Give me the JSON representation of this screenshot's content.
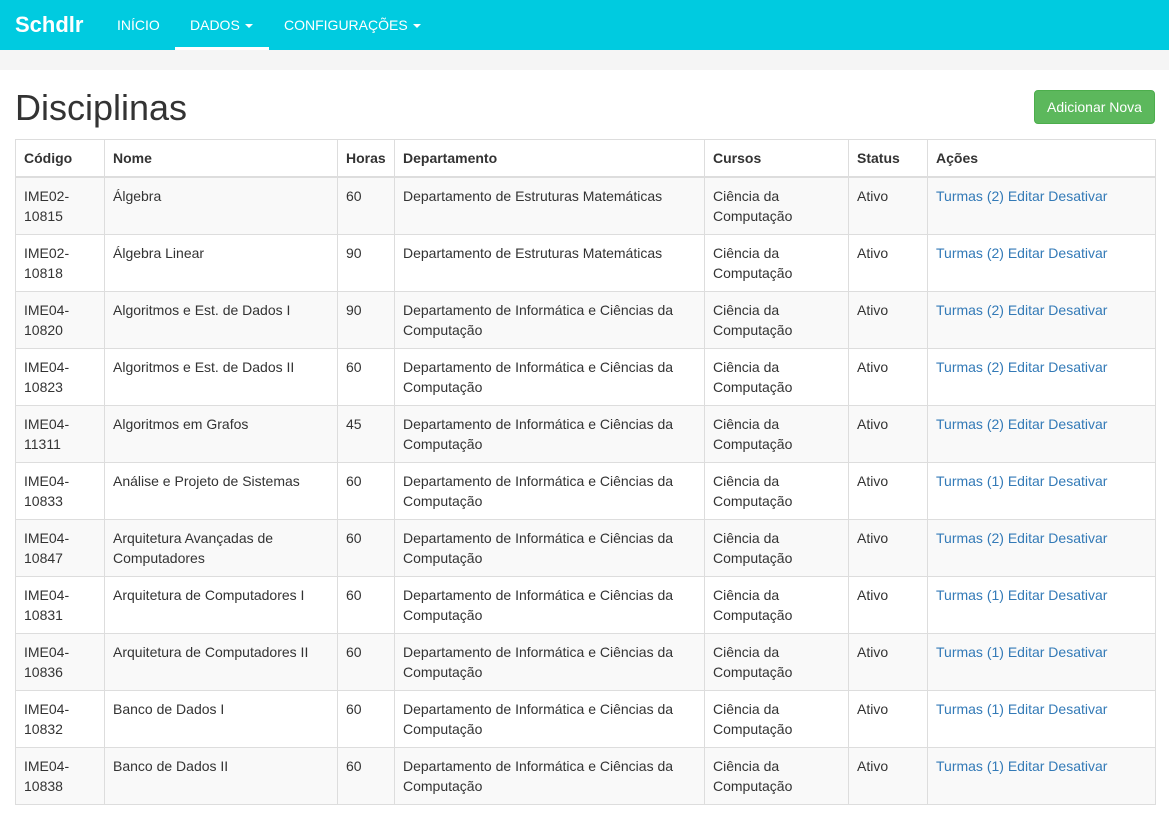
{
  "navbar": {
    "brand": "Schdlr",
    "items": [
      {
        "label": "INÍCIO",
        "dropdown": false
      },
      {
        "label": "DADOS",
        "dropdown": true
      },
      {
        "label": "CONFIGURAÇÕES",
        "dropdown": true
      }
    ]
  },
  "page": {
    "title": "Disciplinas",
    "add_button": "Adicionar Nova"
  },
  "table": {
    "headers": [
      "Código",
      "Nome",
      "Horas",
      "Departamento",
      "Cursos",
      "Status",
      "Ações"
    ],
    "rows": [
      {
        "codigo": "IME02-10815",
        "nome": "Álgebra",
        "horas": "60",
        "departamento": "Departamento de Estruturas Matemáticas",
        "cursos": "Ciência da Computação",
        "status": "Ativo",
        "turmas": "Turmas (2)",
        "editar": "Editar",
        "desativar": "Desativar"
      },
      {
        "codigo": "IME02-10818",
        "nome": "Álgebra Linear",
        "horas": "90",
        "departamento": "Departamento de Estruturas Matemáticas",
        "cursos": "Ciência da Computação",
        "status": "Ativo",
        "turmas": "Turmas (2)",
        "editar": "Editar",
        "desativar": "Desativar"
      },
      {
        "codigo": "IME04-10820",
        "nome": "Algoritmos e Est. de Dados I",
        "horas": "90",
        "departamento": "Departamento de Informática e Ciências da Computação",
        "cursos": "Ciência da Computação",
        "status": "Ativo",
        "turmas": "Turmas (2)",
        "editar": "Editar",
        "desativar": "Desativar"
      },
      {
        "codigo": "IME04-10823",
        "nome": "Algoritmos e Est. de Dados II",
        "horas": "60",
        "departamento": "Departamento de Informática e Ciências da Computação",
        "cursos": "Ciência da Computação",
        "status": "Ativo",
        "turmas": "Turmas (2)",
        "editar": "Editar",
        "desativar": "Desativar"
      },
      {
        "codigo": "IME04-11311",
        "nome": "Algoritmos em Grafos",
        "horas": "45",
        "departamento": "Departamento de Informática e Ciências da Computação",
        "cursos": "Ciência da Computação",
        "status": "Ativo",
        "turmas": "Turmas (2)",
        "editar": "Editar",
        "desativar": "Desativar"
      },
      {
        "codigo": "IME04-10833",
        "nome": "Análise e Projeto de Sistemas",
        "horas": "60",
        "departamento": "Departamento de Informática e Ciências da Computação",
        "cursos": "Ciência da Computação",
        "status": "Ativo",
        "turmas": "Turmas (1)",
        "editar": "Editar",
        "desativar": "Desativar"
      },
      {
        "codigo": "IME04-10847",
        "nome": "Arquitetura Avançadas de Computadores",
        "horas": "60",
        "departamento": "Departamento de Informática e Ciências da Computação",
        "cursos": "Ciência da Computação",
        "status": "Ativo",
        "turmas": "Turmas (2)",
        "editar": "Editar",
        "desativar": "Desativar"
      },
      {
        "codigo": "IME04-10831",
        "nome": "Arquitetura de Computadores I",
        "horas": "60",
        "departamento": "Departamento de Informática e Ciências da Computação",
        "cursos": "Ciência da Computação",
        "status": "Ativo",
        "turmas": "Turmas (1)",
        "editar": "Editar",
        "desativar": "Desativar"
      },
      {
        "codigo": "IME04-10836",
        "nome": "Arquitetura de Computadores II",
        "horas": "60",
        "departamento": "Departamento de Informática e Ciências da Computação",
        "cursos": "Ciência da Computação",
        "status": "Ativo",
        "turmas": "Turmas (1)",
        "editar": "Editar",
        "desativar": "Desativar"
      },
      {
        "codigo": "IME04-10832",
        "nome": "Banco de Dados I",
        "horas": "60",
        "departamento": "Departamento de Informática e Ciências da Computação",
        "cursos": "Ciência da Computação",
        "status": "Ativo",
        "turmas": "Turmas (1)",
        "editar": "Editar",
        "desativar": "Desativar"
      },
      {
        "codigo": "IME04-10838",
        "nome": "Banco de Dados II",
        "horas": "60",
        "departamento": "Departamento de Informática e Ciências da Computação",
        "cursos": "Ciência da Computação",
        "status": "Ativo",
        "turmas": "Turmas (1)",
        "editar": "Editar",
        "desativar": "Desativar"
      }
    ]
  }
}
